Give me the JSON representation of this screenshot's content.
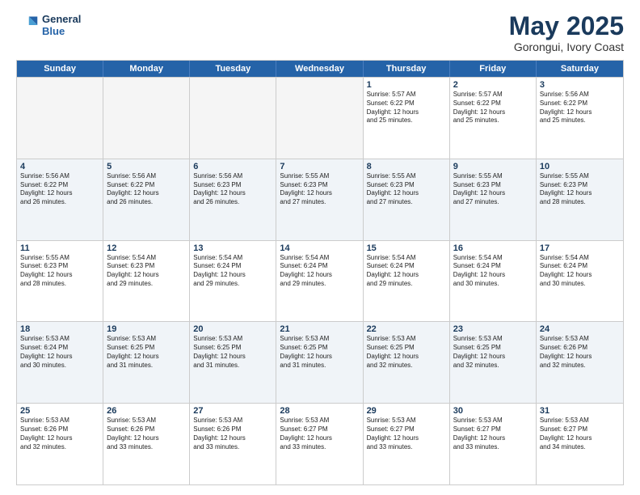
{
  "logo": {
    "line1": "General",
    "line2": "Blue"
  },
  "title": "May 2025",
  "subtitle": "Gorongui, Ivory Coast",
  "days": [
    "Sunday",
    "Monday",
    "Tuesday",
    "Wednesday",
    "Thursday",
    "Friday",
    "Saturday"
  ],
  "rows": [
    [
      {
        "day": "",
        "info": "",
        "empty": true
      },
      {
        "day": "",
        "info": "",
        "empty": true
      },
      {
        "day": "",
        "info": "",
        "empty": true
      },
      {
        "day": "",
        "info": "",
        "empty": true
      },
      {
        "day": "1",
        "info": "Sunrise: 5:57 AM\nSunset: 6:22 PM\nDaylight: 12 hours\nand 25 minutes."
      },
      {
        "day": "2",
        "info": "Sunrise: 5:57 AM\nSunset: 6:22 PM\nDaylight: 12 hours\nand 25 minutes."
      },
      {
        "day": "3",
        "info": "Sunrise: 5:56 AM\nSunset: 6:22 PM\nDaylight: 12 hours\nand 25 minutes."
      }
    ],
    [
      {
        "day": "4",
        "info": "Sunrise: 5:56 AM\nSunset: 6:22 PM\nDaylight: 12 hours\nand 26 minutes."
      },
      {
        "day": "5",
        "info": "Sunrise: 5:56 AM\nSunset: 6:22 PM\nDaylight: 12 hours\nand 26 minutes."
      },
      {
        "day": "6",
        "info": "Sunrise: 5:56 AM\nSunset: 6:23 PM\nDaylight: 12 hours\nand 26 minutes."
      },
      {
        "day": "7",
        "info": "Sunrise: 5:55 AM\nSunset: 6:23 PM\nDaylight: 12 hours\nand 27 minutes."
      },
      {
        "day": "8",
        "info": "Sunrise: 5:55 AM\nSunset: 6:23 PM\nDaylight: 12 hours\nand 27 minutes."
      },
      {
        "day": "9",
        "info": "Sunrise: 5:55 AM\nSunset: 6:23 PM\nDaylight: 12 hours\nand 27 minutes."
      },
      {
        "day": "10",
        "info": "Sunrise: 5:55 AM\nSunset: 6:23 PM\nDaylight: 12 hours\nand 28 minutes."
      }
    ],
    [
      {
        "day": "11",
        "info": "Sunrise: 5:55 AM\nSunset: 6:23 PM\nDaylight: 12 hours\nand 28 minutes."
      },
      {
        "day": "12",
        "info": "Sunrise: 5:54 AM\nSunset: 6:23 PM\nDaylight: 12 hours\nand 29 minutes."
      },
      {
        "day": "13",
        "info": "Sunrise: 5:54 AM\nSunset: 6:24 PM\nDaylight: 12 hours\nand 29 minutes."
      },
      {
        "day": "14",
        "info": "Sunrise: 5:54 AM\nSunset: 6:24 PM\nDaylight: 12 hours\nand 29 minutes."
      },
      {
        "day": "15",
        "info": "Sunrise: 5:54 AM\nSunset: 6:24 PM\nDaylight: 12 hours\nand 29 minutes."
      },
      {
        "day": "16",
        "info": "Sunrise: 5:54 AM\nSunset: 6:24 PM\nDaylight: 12 hours\nand 30 minutes."
      },
      {
        "day": "17",
        "info": "Sunrise: 5:54 AM\nSunset: 6:24 PM\nDaylight: 12 hours\nand 30 minutes."
      }
    ],
    [
      {
        "day": "18",
        "info": "Sunrise: 5:53 AM\nSunset: 6:24 PM\nDaylight: 12 hours\nand 30 minutes."
      },
      {
        "day": "19",
        "info": "Sunrise: 5:53 AM\nSunset: 6:25 PM\nDaylight: 12 hours\nand 31 minutes."
      },
      {
        "day": "20",
        "info": "Sunrise: 5:53 AM\nSunset: 6:25 PM\nDaylight: 12 hours\nand 31 minutes."
      },
      {
        "day": "21",
        "info": "Sunrise: 5:53 AM\nSunset: 6:25 PM\nDaylight: 12 hours\nand 31 minutes."
      },
      {
        "day": "22",
        "info": "Sunrise: 5:53 AM\nSunset: 6:25 PM\nDaylight: 12 hours\nand 32 minutes."
      },
      {
        "day": "23",
        "info": "Sunrise: 5:53 AM\nSunset: 6:25 PM\nDaylight: 12 hours\nand 32 minutes."
      },
      {
        "day": "24",
        "info": "Sunrise: 5:53 AM\nSunset: 6:26 PM\nDaylight: 12 hours\nand 32 minutes."
      }
    ],
    [
      {
        "day": "25",
        "info": "Sunrise: 5:53 AM\nSunset: 6:26 PM\nDaylight: 12 hours\nand 32 minutes."
      },
      {
        "day": "26",
        "info": "Sunrise: 5:53 AM\nSunset: 6:26 PM\nDaylight: 12 hours\nand 33 minutes."
      },
      {
        "day": "27",
        "info": "Sunrise: 5:53 AM\nSunset: 6:26 PM\nDaylight: 12 hours\nand 33 minutes."
      },
      {
        "day": "28",
        "info": "Sunrise: 5:53 AM\nSunset: 6:27 PM\nDaylight: 12 hours\nand 33 minutes."
      },
      {
        "day": "29",
        "info": "Sunrise: 5:53 AM\nSunset: 6:27 PM\nDaylight: 12 hours\nand 33 minutes."
      },
      {
        "day": "30",
        "info": "Sunrise: 5:53 AM\nSunset: 6:27 PM\nDaylight: 12 hours\nand 33 minutes."
      },
      {
        "day": "31",
        "info": "Sunrise: 5:53 AM\nSunset: 6:27 PM\nDaylight: 12 hours\nand 34 minutes."
      }
    ]
  ]
}
